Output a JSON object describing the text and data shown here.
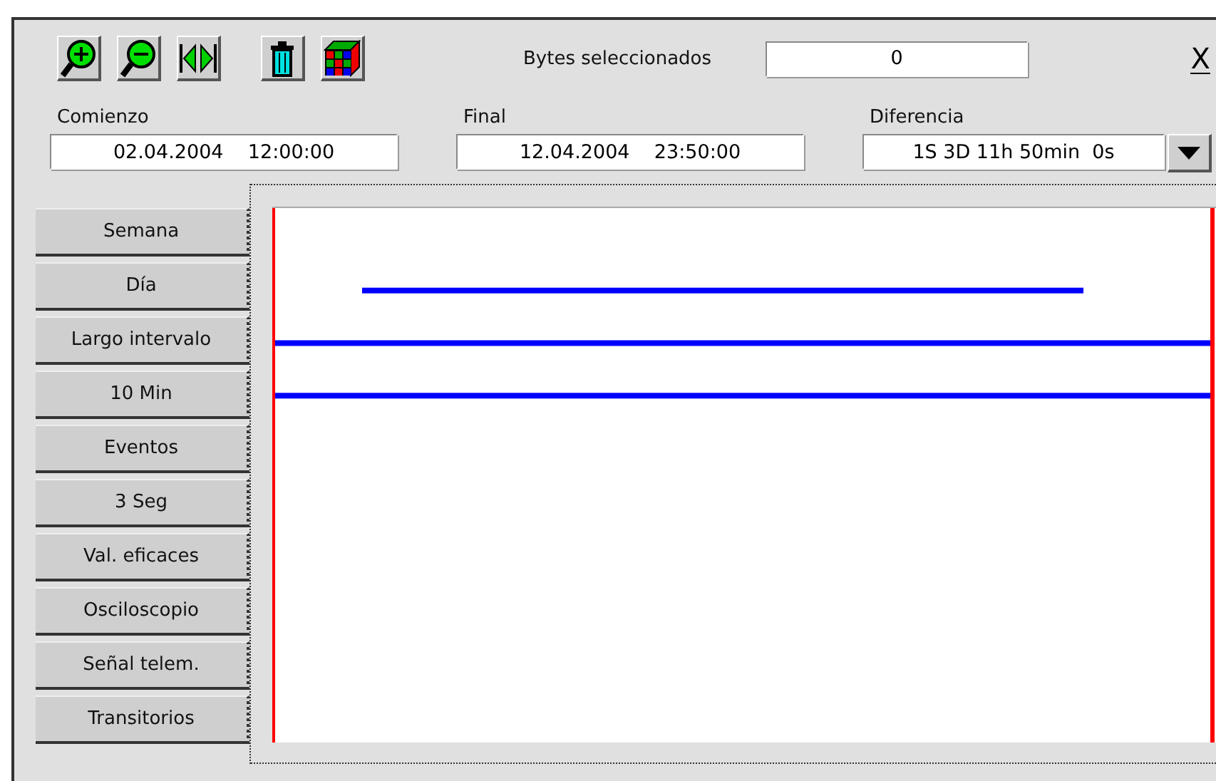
{
  "toolbar": {
    "buttons": [
      {
        "kind": "zoom-in"
      },
      {
        "kind": "zoom-out"
      },
      {
        "kind": "fit"
      },
      {
        "kind": "delete"
      },
      {
        "kind": "cube"
      }
    ],
    "bytes_label": "Bytes seleccionados",
    "bytes_value": "0",
    "close": "X"
  },
  "range": [
    {
      "kind": "date",
      "label": "Comienzo",
      "value": "02.04.2004    12:00:00"
    },
    {
      "kind": "date",
      "label": "Final",
      "value": "12.04.2004    23:50:00"
    },
    {
      "kind": "dropdown",
      "label": "Diferencia",
      "value": "1S 3D 11h 50min  0s"
    }
  ],
  "views": [
    "Semana",
    "Día",
    "Largo intervalo",
    "10 Min",
    "Eventos",
    "3 Seg",
    "Val. eficaces",
    "Osciloscopio",
    "Señal telem.",
    "Transitorios"
  ]
}
